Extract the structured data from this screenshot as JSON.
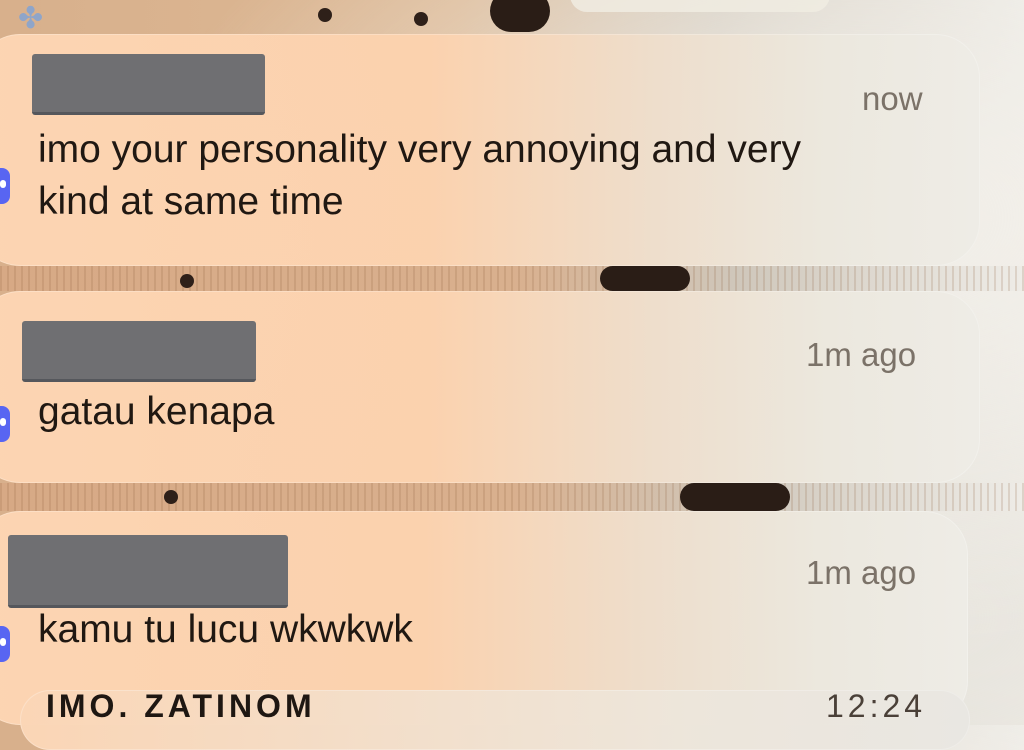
{
  "notifications": [
    {
      "sender": "",
      "time": "now",
      "message_lines": [
        "imo your personality very annoying and very",
        "kind at same time"
      ]
    },
    {
      "sender": "",
      "time": "1m ago",
      "message_lines": [
        "gatau kenapa"
      ]
    },
    {
      "sender": "",
      "time": "1m ago",
      "message_lines": [
        "kamu tu lucu wkwkwk"
      ]
    }
  ],
  "partial_next": {
    "sender_fragment": "IMO. ZATINOM",
    "time_fragment": "12:24"
  },
  "colors": {
    "app_icon": "#5865f2",
    "redaction": "#6f6f72",
    "time_text": "#7b7268",
    "message_text": "#201812"
  },
  "icons": {
    "app_icon": "discord-app-icon"
  }
}
